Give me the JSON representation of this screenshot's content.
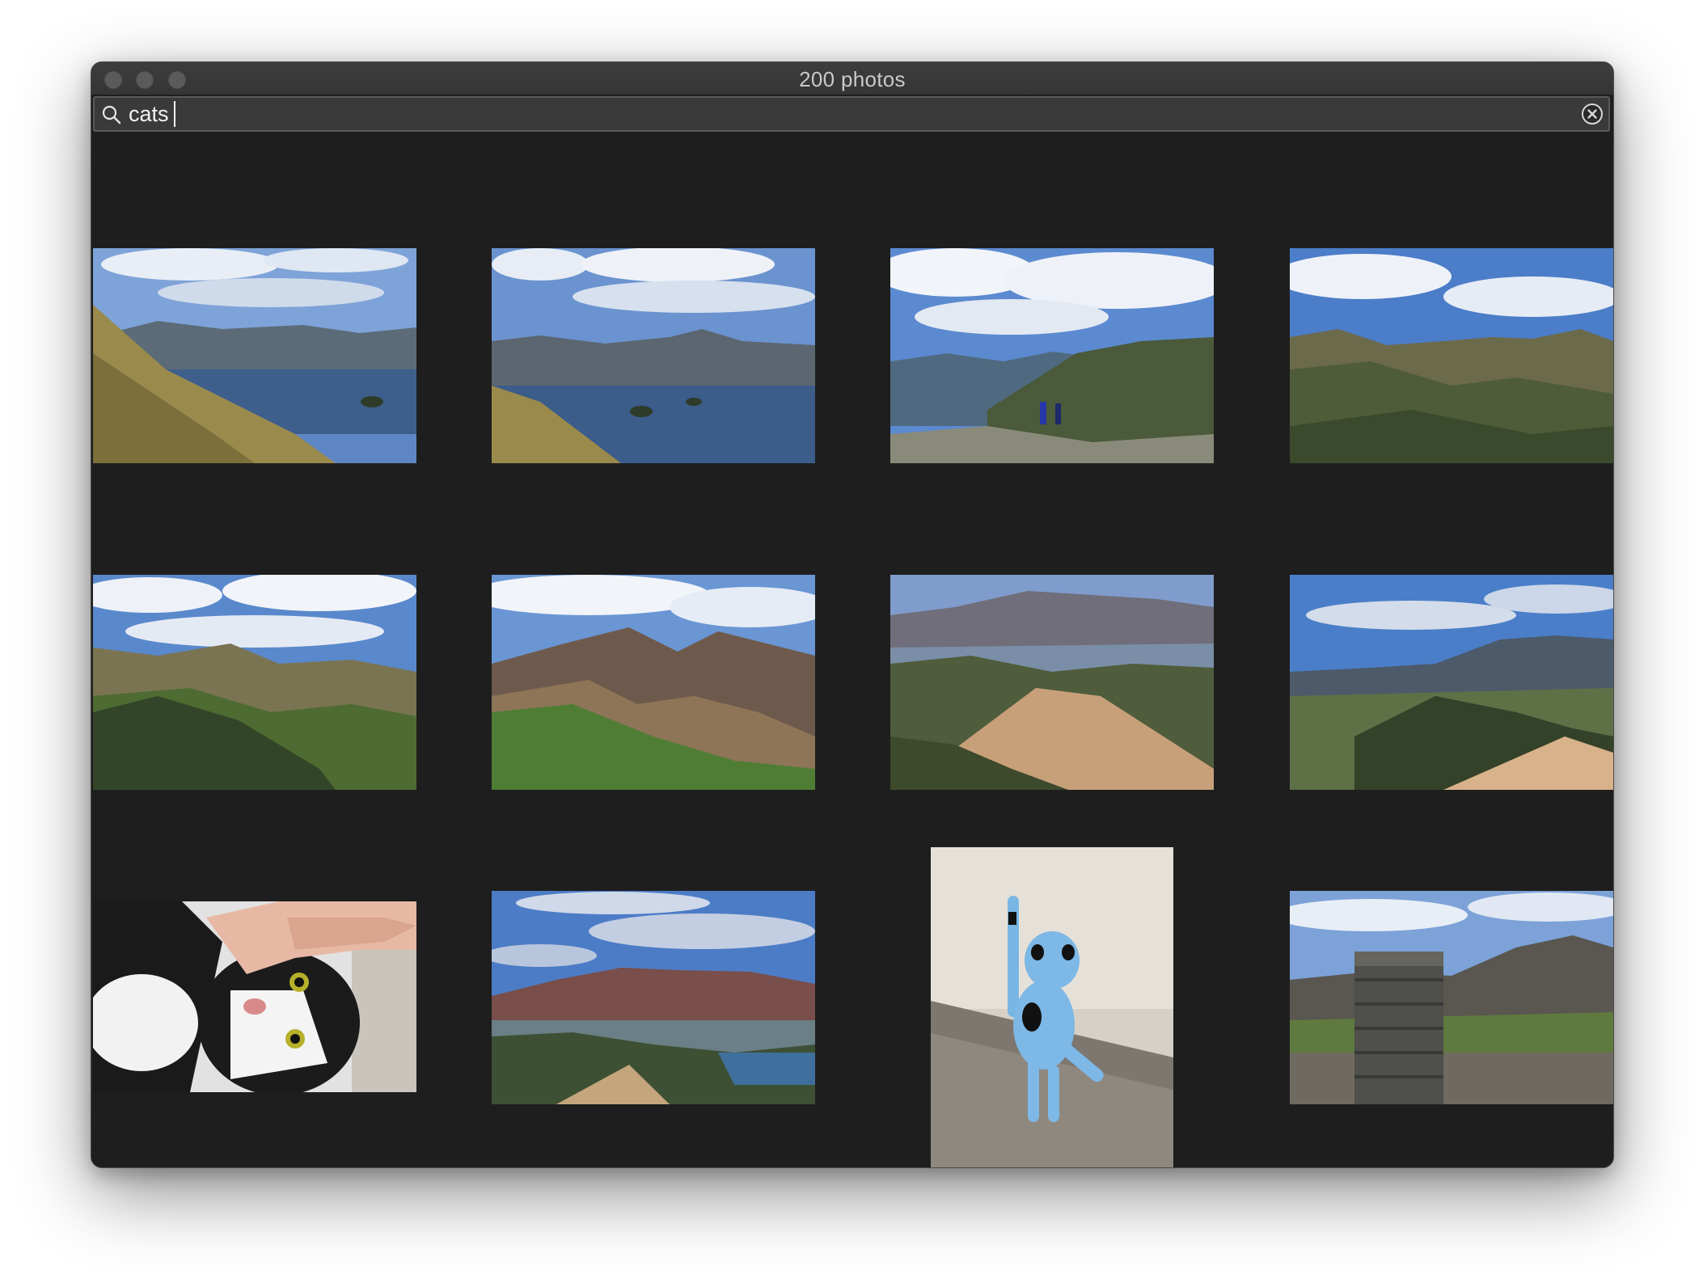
{
  "window": {
    "title": "200 photos",
    "traffic_lights": [
      "close",
      "minimize",
      "zoom"
    ]
  },
  "search": {
    "icon": "search-icon",
    "value": "cats",
    "placeholder": "",
    "clear_icon": "clear-icon"
  },
  "photos": [
    {
      "subject": "landscape-lake-view"
    },
    {
      "subject": "landscape-lake-view"
    },
    {
      "subject": "landscape-hikers-summit"
    },
    {
      "subject": "landscape-mountain-valley"
    },
    {
      "subject": "landscape-mountain-valley"
    },
    {
      "subject": "landscape-mountain-ridge"
    },
    {
      "subject": "landscape-ridge-path"
    },
    {
      "subject": "landscape-ridge-path"
    },
    {
      "subject": "cat-being-petted"
    },
    {
      "subject": "landscape-lake-view"
    },
    {
      "subject": "blue-wooden-cat-figurine"
    },
    {
      "subject": "landscape-stone-cairn"
    }
  ]
}
